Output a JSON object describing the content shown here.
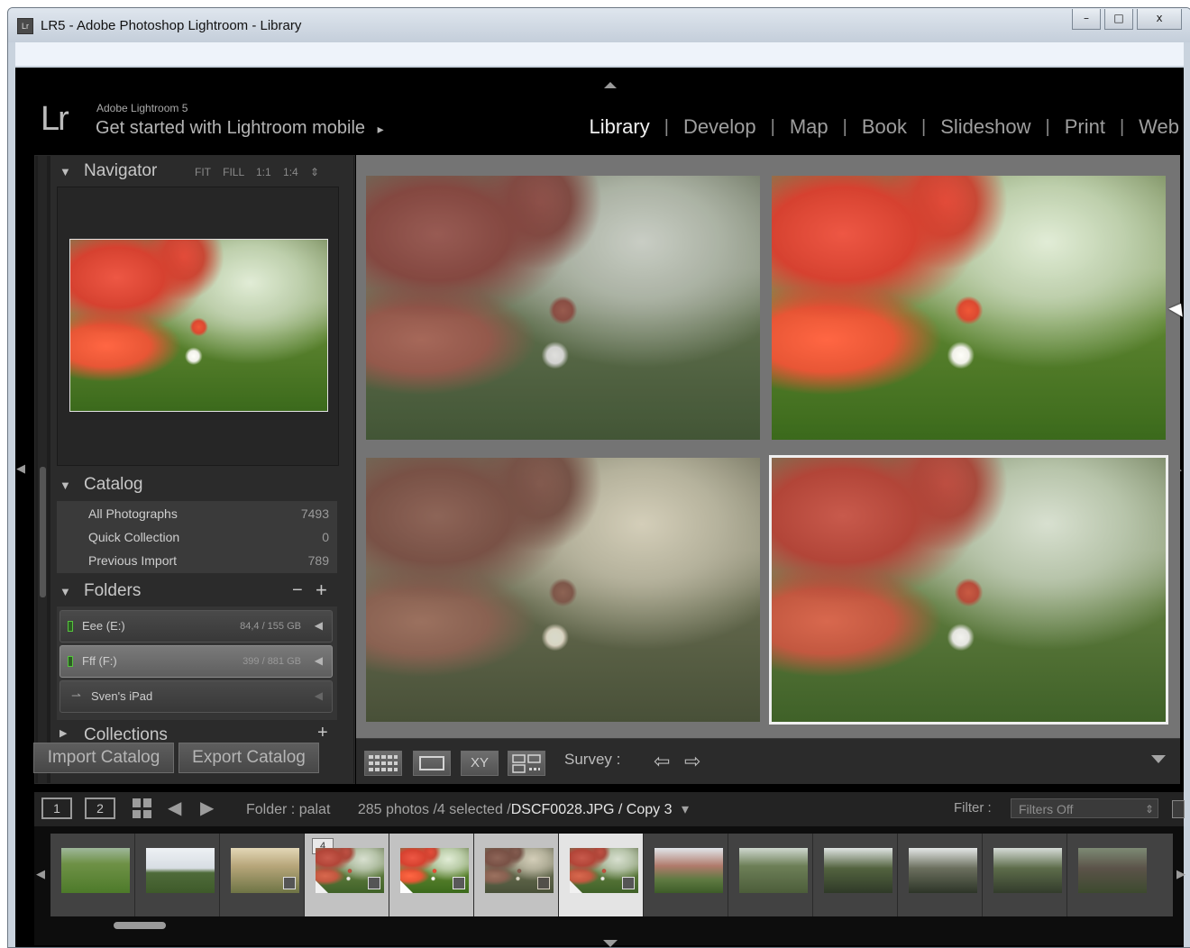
{
  "window": {
    "app_icon": "Lr",
    "title": "LR5 - Adobe Photoshop Lightroom - Library",
    "minimize": "–",
    "maximize": "□",
    "close": "x"
  },
  "identity": {
    "logo": "Lr",
    "version": "Adobe Lightroom 5",
    "mobile": "Get started with Lightroom mobile",
    "mobile_arrow": "▸"
  },
  "modules": {
    "items": [
      "Library",
      "Develop",
      "Map",
      "Book",
      "Slideshow",
      "Print",
      "Web"
    ],
    "active": "Library"
  },
  "navigator": {
    "title": "Navigator",
    "options": "FIT FILL 1:1 1:4 ⇕"
  },
  "catalog": {
    "title": "Catalog",
    "items": [
      {
        "label": "All Photographs",
        "count": "7493"
      },
      {
        "label": "Quick Collection",
        "count": "0"
      },
      {
        "label": "Previous Import",
        "count": "789"
      }
    ]
  },
  "folders": {
    "title": "Folders",
    "remove": "−",
    "add": "+",
    "drives": [
      {
        "label": "Eee (E:)",
        "size": "84,4 / 155 GB",
        "arrow": "◀"
      },
      {
        "label": "Fff (F:)",
        "size": "399 / 881 GB",
        "arrow": "◀"
      },
      {
        "label": "Sven's iPad",
        "size": "",
        "arrow": "◀"
      }
    ]
  },
  "collections": {
    "title": "Collections",
    "add": "+"
  },
  "left_buttons": {
    "import": "Import Catalog",
    "export": "Export Catalog"
  },
  "toolbar": {
    "compare_label": "XY",
    "survey_label": "Survey :",
    "prev_icon": "⇦",
    "next_icon": "⇨"
  },
  "filmstrip_bar": {
    "monitor1": "1",
    "monitor2": "2",
    "prev": "◀",
    "next": "▶",
    "folder": "Folder : palat",
    "count": "285 photos /4 selected /",
    "filename": "DSCF0028.JPG / Copy 3",
    "dropdown": "▾",
    "filter_label": "Filter :",
    "filter_value": "Filters Off",
    "filter_arrows": "⇕"
  },
  "filmstrip": {
    "selected_badge": "4",
    "thumbs": [
      {
        "kind": "dog"
      },
      {
        "kind": "landscape"
      },
      {
        "kind": "field"
      },
      {
        "kind": "poppy",
        "selected": true,
        "badge": true
      },
      {
        "kind": "poppy",
        "selected": true
      },
      {
        "kind": "poppy-dark",
        "selected": true
      },
      {
        "kind": "poppy",
        "selected": true
      },
      {
        "kind": "house"
      },
      {
        "kind": "people"
      },
      {
        "kind": "people"
      },
      {
        "kind": "people"
      },
      {
        "kind": "people"
      },
      {
        "kind": "people"
      }
    ]
  },
  "colors": {
    "panel_bg": "#2b2b2b",
    "grid_bg": "#747474",
    "active_module": "#f0f0f0",
    "selection": "#efefef"
  }
}
